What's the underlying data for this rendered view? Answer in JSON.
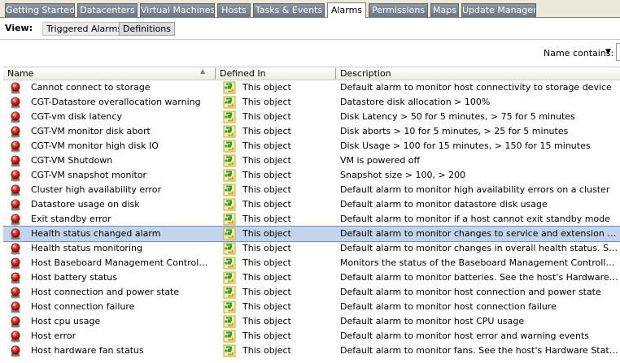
{
  "tabs": [
    {
      "label": "Getting Started"
    },
    {
      "label": "Datacenters"
    },
    {
      "label": "Virtual Machines"
    },
    {
      "label": "Hosts"
    },
    {
      "label": "Tasks & Events"
    },
    {
      "label": "Alarms"
    },
    {
      "label": "Permissions"
    },
    {
      "label": "Maps"
    },
    {
      "label": "Update Manager"
    }
  ],
  "active_tab": "Alarms",
  "view": {
    "label": "View:",
    "triggered_label": "Triggered Alarms",
    "definitions_label": "Definitions",
    "selected": "Definitions"
  },
  "filter": {
    "name_contains_label": "Name contains:"
  },
  "columns": {
    "name": "Name",
    "defined_in": "Defined In",
    "description": "Description"
  },
  "rows": [
    {
      "name": "Cannot connect to storage",
      "defined_in": "This object",
      "description": "Default alarm to monitor host connectivity to storage device"
    },
    {
      "name": "CGT-Datastore overallocation warning",
      "defined_in": "This object",
      "description": "Datastore disk allocation > 100%"
    },
    {
      "name": "CGT-vm disk latency",
      "defined_in": "This object",
      "description": "Disk Latency > 50 for 5 minutes, > 75 for 5 minutes"
    },
    {
      "name": "CGT-VM monitor disk abort",
      "defined_in": "This object",
      "description": "Disk aborts > 10 for 5 minutes, > 25 for 5 minutes"
    },
    {
      "name": "CGT-VM monitor high disk IO",
      "defined_in": "This object",
      "description": "Disk Usage > 100 for 15 minutes, > 150 for 15 minutes"
    },
    {
      "name": "CGT-VM Shutdown",
      "defined_in": "This object",
      "description": "VM is powered off"
    },
    {
      "name": "CGT-VM snapshot monitor",
      "defined_in": "This object",
      "description": "Snapshot size > 100, > 200"
    },
    {
      "name": "Cluster high availability error",
      "defined_in": "This object",
      "description": "Default alarm to monitor high availability errors on a cluster"
    },
    {
      "name": "Datastore usage on disk",
      "defined_in": "This object",
      "description": "Default alarm to monitor datastore disk usage"
    },
    {
      "name": "Exit standby error",
      "defined_in": "This object",
      "description": "Default alarm to monitor if a host cannot exit standby mode"
    },
    {
      "name": "Health status changed alarm",
      "defined_in": "This object",
      "description": "Default alarm to monitor changes to service and extension health sta..."
    },
    {
      "name": "Health status monitoring",
      "defined_in": "This object",
      "description": "Default alarm to monitor changes in overall health status. See vCenter..."
    },
    {
      "name": "Host Baseboard Management Controller st...",
      "defined_in": "This object",
      "description": "Monitors the status of the Baseboard Management Controller. See the..."
    },
    {
      "name": "Host battery status",
      "defined_in": "This object",
      "description": "Default alarm to monitor batteries.  See the host's Hardware Status T..."
    },
    {
      "name": "Host connection and power state",
      "defined_in": "This object",
      "description": "Default alarm to monitor host connection and power state"
    },
    {
      "name": "Host connection failure",
      "defined_in": "This object",
      "description": "Default alarm to monitor host connection failure"
    },
    {
      "name": "Host cpu usage",
      "defined_in": "This object",
      "description": "Default alarm to monitor host CPU usage"
    },
    {
      "name": "Host error",
      "defined_in": "This object",
      "description": "Default alarm to monitor host error and warning events"
    },
    {
      "name": "Host hardware fan status",
      "defined_in": "This object",
      "description": "Default alarm to monitor fans.  See the host's Hardware Status Tab for..."
    }
  ],
  "selected_row": 10,
  "icons": {
    "alarm": "alarm-definition-icon",
    "defined_in": "object-icon"
  }
}
